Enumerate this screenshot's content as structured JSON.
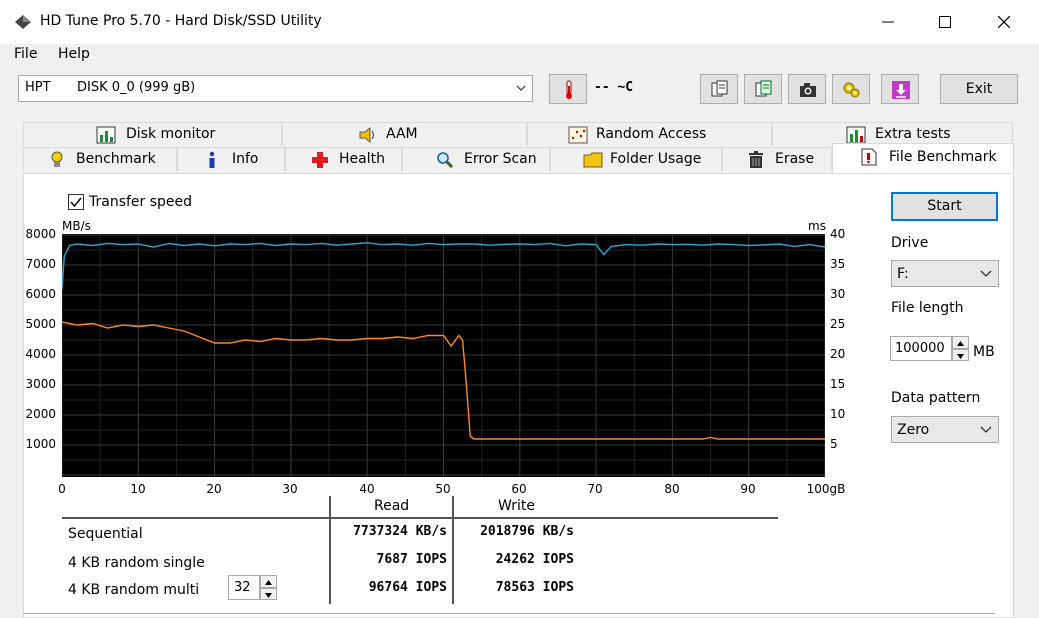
{
  "window": {
    "title": "HD Tune Pro 5.70 - Hard Disk/SSD Utility"
  },
  "menu": {
    "file_label": "File",
    "help_label": "Help"
  },
  "toolbar": {
    "disk_model": "HPT",
    "disk_name": "DISK 0_0 (999 gB)",
    "temperature": "-- ~C",
    "exit_label": "Exit"
  },
  "tabs_top": [
    {
      "label": "Disk monitor",
      "icon": "disk-monitor-icon"
    },
    {
      "label": "AAM",
      "icon": "speaker-icon"
    },
    {
      "label": "Random Access",
      "icon": "random-access-icon"
    },
    {
      "label": "Extra tests",
      "icon": "extra-tests-icon"
    }
  ],
  "tabs_bottom": [
    {
      "label": "Benchmark",
      "icon": "bulb-icon"
    },
    {
      "label": "Info",
      "icon": "info-icon"
    },
    {
      "label": "Health",
      "icon": "health-cross-icon"
    },
    {
      "label": "Error Scan",
      "icon": "magnifier-icon"
    },
    {
      "label": "Folder Usage",
      "icon": "folder-icon"
    },
    {
      "label": "Erase",
      "icon": "trash-icon"
    },
    {
      "label": "File Benchmark",
      "icon": "file-benchmark-icon",
      "active": true
    }
  ],
  "benchmark": {
    "transfer_speed_label": "Transfer speed",
    "transfer_speed_checked": true
  },
  "controls": {
    "start_label": "Start",
    "drive_label": "Drive",
    "drive_value": "F:",
    "file_length_label": "File length",
    "file_length_value": "100000",
    "file_length_unit": "MB",
    "data_pattern_label": "Data pattern",
    "data_pattern_value": "Zero"
  },
  "results": {
    "read_header": "Read",
    "write_header": "Write",
    "rows": [
      {
        "label": "Sequential",
        "read": "7737324 KB/s",
        "write": "2018796 KB/s"
      },
      {
        "label": "4 KB random single",
        "read": "7687 IOPS",
        "write": "24262 IOPS"
      },
      {
        "label": "4 KB random multi",
        "read": "96764 IOPS",
        "write": "78563 IOPS"
      }
    ],
    "queue_depth": "32"
  },
  "chart_data": {
    "type": "line",
    "ylabel_left": "MB/s",
    "ylabel_right": "ms",
    "xunit": "gB",
    "xlim": [
      0,
      100
    ],
    "ylim_left": [
      0,
      8000
    ],
    "ylim_right": [
      0,
      40
    ],
    "y_ticks_left": [
      "8000",
      "7000",
      "6000",
      "5000",
      "4000",
      "3000",
      "2000",
      "1000"
    ],
    "y_ticks_right": [
      "40",
      "35",
      "30",
      "25",
      "20",
      "15",
      "10",
      "5"
    ],
    "x_ticks": [
      "0",
      "10",
      "20",
      "30",
      "40",
      "50",
      "60",
      "70",
      "80",
      "90",
      "100gB"
    ],
    "grid": true,
    "series": [
      {
        "color": "#2aa7d8",
        "x": [
          0,
          0.3,
          1,
          2,
          4,
          6,
          8,
          10,
          12,
          14,
          16,
          18,
          20,
          22,
          24,
          26,
          28,
          30,
          32,
          34,
          36,
          38,
          40,
          42,
          44,
          46,
          48,
          50,
          52,
          54,
          56,
          58,
          60,
          62,
          64,
          66,
          68,
          70,
          71,
          72,
          74,
          76,
          78,
          80,
          82,
          84,
          86,
          88,
          90,
          92,
          94,
          96,
          98,
          100
        ],
        "y": [
          6200,
          7300,
          7650,
          7700,
          7650,
          7720,
          7680,
          7700,
          7600,
          7720,
          7650,
          7700,
          7640,
          7700,
          7680,
          7720,
          7650,
          7700,
          7680,
          7720,
          7660,
          7700,
          7740,
          7680,
          7700,
          7660,
          7720,
          7680,
          7700,
          7700,
          7660,
          7690,
          7700,
          7680,
          7720,
          7640,
          7700,
          7680,
          7350,
          7620,
          7680,
          7660,
          7700,
          7680,
          7690,
          7660,
          7700,
          7680,
          7650,
          7670,
          7700,
          7620,
          7680,
          7600
        ]
      },
      {
        "color": "#ff8a1c",
        "x": [
          0,
          2,
          4,
          6,
          8,
          10,
          12,
          14,
          16,
          18,
          20,
          22,
          24,
          26,
          28,
          30,
          32,
          34,
          36,
          38,
          40,
          42,
          44,
          46,
          48,
          50,
          51,
          52,
          52.5,
          53,
          53.5,
          54,
          56,
          60,
          65,
          70,
          75,
          80,
          84,
          85,
          86,
          90,
          95,
          100
        ],
        "y": [
          5100,
          5000,
          5050,
          4900,
          5000,
          4950,
          5000,
          4900,
          4800,
          4600,
          4400,
          4400,
          4500,
          4450,
          4550,
          4500,
          4500,
          4550,
          4500,
          4500,
          4550,
          4550,
          4600,
          4550,
          4650,
          4650,
          4300,
          4650,
          4500,
          3000,
          1300,
          1200,
          1200,
          1200,
          1200,
          1200,
          1200,
          1200,
          1200,
          1250,
          1200,
          1200,
          1200,
          1200
        ]
      }
    ]
  }
}
